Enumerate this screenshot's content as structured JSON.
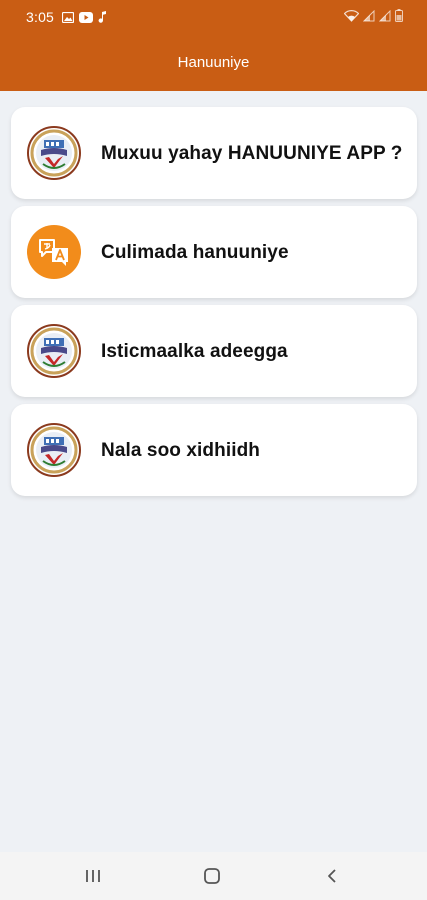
{
  "status_bar": {
    "time": "3:05",
    "left_icons": [
      "gallery-icon",
      "youtube-icon",
      "music-note-icon"
    ],
    "right_icons": [
      "wifi-icon",
      "signal-icon",
      "signal-icon",
      "battery-icon"
    ]
  },
  "app_bar": {
    "title": "Hanuuniye"
  },
  "menu": {
    "items": [
      {
        "label": "Muxuu yahay HANUUNIYE APP ?",
        "icon": "hanuuniye-emblem-icon"
      },
      {
        "label": "Culimada hanuuniye",
        "icon": "translate-chat-icon"
      },
      {
        "label": "Isticmaalka adeegga",
        "icon": "hanuuniye-emblem-icon"
      },
      {
        "label": "Nala soo xidhiidh",
        "icon": "hanuuniye-emblem-icon"
      }
    ]
  },
  "nav_bar": {
    "icons": [
      "recent-apps-icon",
      "home-icon",
      "back-icon"
    ]
  },
  "colors": {
    "accent": "#c95d14",
    "background": "#eef1f5",
    "card": "#ffffff",
    "icon_orange": "#f28c1b"
  }
}
